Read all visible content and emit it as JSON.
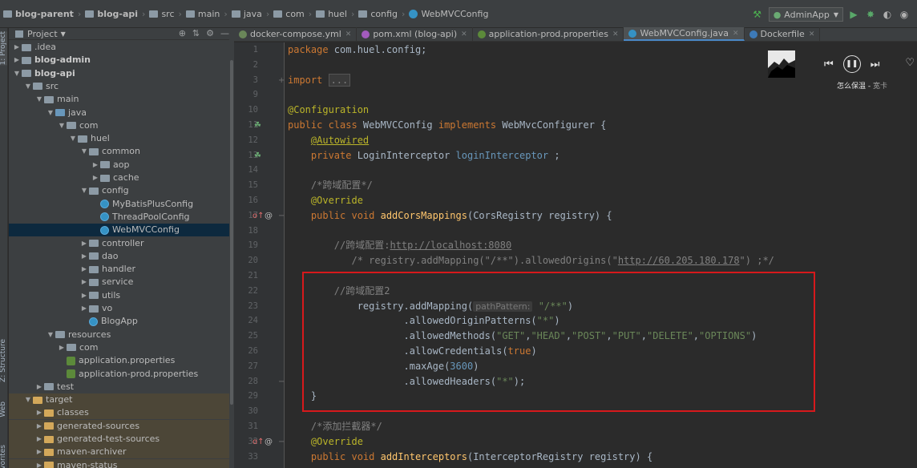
{
  "breadcrumb": [
    "blog-parent",
    "blog-api",
    "src",
    "main",
    "java",
    "com",
    "huel",
    "config",
    "WebMVCConfig"
  ],
  "run_config": "AdminApp",
  "left_strip": {
    "project": "1: Project",
    "structure": "Z: Structure",
    "web": "Web",
    "favorites": "Favorites"
  },
  "project_header": {
    "title": "Project"
  },
  "tree": [
    {
      "label": ".idea",
      "depth": 1,
      "expanded": false,
      "icon": "folder"
    },
    {
      "label": "blog-admin",
      "depth": 1,
      "expanded": false,
      "icon": "folder",
      "bold": true
    },
    {
      "label": "blog-api",
      "depth": 1,
      "expanded": true,
      "icon": "folder",
      "bold": true
    },
    {
      "label": "src",
      "depth": 2,
      "expanded": true,
      "icon": "folder"
    },
    {
      "label": "main",
      "depth": 3,
      "expanded": true,
      "icon": "folder"
    },
    {
      "label": "java",
      "depth": 4,
      "expanded": true,
      "icon": "folder-blue"
    },
    {
      "label": "com",
      "depth": 5,
      "expanded": true,
      "icon": "folder"
    },
    {
      "label": "huel",
      "depth": 6,
      "expanded": true,
      "icon": "folder"
    },
    {
      "label": "common",
      "depth": 7,
      "expanded": true,
      "icon": "folder"
    },
    {
      "label": "aop",
      "depth": 8,
      "expanded": false,
      "icon": "folder"
    },
    {
      "label": "cache",
      "depth": 8,
      "expanded": false,
      "icon": "folder"
    },
    {
      "label": "config",
      "depth": 7,
      "expanded": true,
      "icon": "folder"
    },
    {
      "label": "MyBatisPlusConfig",
      "depth": 8,
      "icon": "class"
    },
    {
      "label": "ThreadPoolConfig",
      "depth": 8,
      "icon": "class"
    },
    {
      "label": "WebMVCConfig",
      "depth": 8,
      "icon": "class",
      "selected": true
    },
    {
      "label": "controller",
      "depth": 7,
      "expanded": false,
      "icon": "folder"
    },
    {
      "label": "dao",
      "depth": 7,
      "expanded": false,
      "icon": "folder"
    },
    {
      "label": "handler",
      "depth": 7,
      "expanded": false,
      "icon": "folder"
    },
    {
      "label": "service",
      "depth": 7,
      "expanded": false,
      "icon": "folder"
    },
    {
      "label": "utils",
      "depth": 7,
      "expanded": false,
      "icon": "folder"
    },
    {
      "label": "vo",
      "depth": 7,
      "expanded": false,
      "icon": "folder"
    },
    {
      "label": "BlogApp",
      "depth": 7,
      "icon": "class"
    },
    {
      "label": "resources",
      "depth": 4,
      "expanded": true,
      "icon": "folder"
    },
    {
      "label": "com",
      "depth": 5,
      "expanded": false,
      "icon": "folder"
    },
    {
      "label": "application.properties",
      "depth": 5,
      "icon": "properties"
    },
    {
      "label": "application-prod.properties",
      "depth": 5,
      "icon": "properties"
    },
    {
      "label": "test",
      "depth": 3,
      "expanded": false,
      "icon": "folder"
    },
    {
      "label": "target",
      "depth": 2,
      "expanded": true,
      "icon": "folder-orange",
      "target": true
    },
    {
      "label": "classes",
      "depth": 3,
      "expanded": false,
      "icon": "folder-orange",
      "target": true
    },
    {
      "label": "generated-sources",
      "depth": 3,
      "expanded": false,
      "icon": "folder-orange",
      "target": true
    },
    {
      "label": "generated-test-sources",
      "depth": 3,
      "expanded": false,
      "icon": "folder-orange",
      "target": true
    },
    {
      "label": "maven-archiver",
      "depth": 3,
      "expanded": false,
      "icon": "folder-orange",
      "target": true
    },
    {
      "label": "maven-status",
      "depth": 3,
      "expanded": false,
      "icon": "folder-orange",
      "target": true
    }
  ],
  "tabs": [
    {
      "label": "docker-compose.yml",
      "icon": "#6a8759"
    },
    {
      "label": "pom.xml (blog-api)",
      "icon": "#a35bbd",
      "letter": "m"
    },
    {
      "label": "application-prod.properties",
      "icon": "#5c8a3a"
    },
    {
      "label": "WebMVCConfig.java",
      "icon": "#3592c4",
      "active": true
    },
    {
      "label": "Dockerfile",
      "icon": "#3d7ab8"
    }
  ],
  "code": [
    {
      "n": "1",
      "t": [
        [
          "kw",
          "package "
        ],
        [
          "",
          "com.huel.config;"
        ]
      ]
    },
    {
      "n": "2",
      "t": []
    },
    {
      "n": "3",
      "t": [
        [
          "kw",
          "import "
        ],
        [
          "fold-box",
          "..."
        ]
      ]
    },
    {
      "n": "9",
      "t": []
    },
    {
      "n": "10",
      "t": [
        [
          "an",
          "@Configuration"
        ]
      ]
    },
    {
      "n": "11",
      "t": [
        [
          "kw",
          "public class "
        ],
        [
          "",
          "WebMVCConfig "
        ],
        [
          "kw",
          "implements "
        ],
        [
          "",
          "WebMvcConfigurer {"
        ]
      ]
    },
    {
      "n": "12",
      "t": [
        [
          "",
          "    "
        ],
        [
          "an ul",
          "@Autowired"
        ]
      ]
    },
    {
      "n": "13",
      "t": [
        [
          "",
          "    "
        ],
        [
          "kw",
          "private "
        ],
        [
          "",
          "LoginInterceptor "
        ],
        [
          "nm",
          "loginInterceptor"
        ],
        [
          "",
          " ;"
        ]
      ]
    },
    {
      "n": "14",
      "t": []
    },
    {
      "n": "15",
      "t": [
        [
          "",
          "    "
        ],
        [
          "cm",
          "/*跨域配置*/"
        ]
      ]
    },
    {
      "n": "16",
      "t": [
        [
          "",
          "    "
        ],
        [
          "an",
          "@Override"
        ]
      ]
    },
    {
      "n": "17",
      "t": [
        [
          "",
          "    "
        ],
        [
          "kw",
          "public void "
        ],
        [
          "fn",
          "addCorsMappings"
        ],
        [
          "",
          "(CorsRegistry registry) {"
        ]
      ]
    },
    {
      "n": "18",
      "t": []
    },
    {
      "n": "19",
      "t": [
        [
          "",
          "        "
        ],
        [
          "cm",
          "//跨域配置:"
        ],
        [
          "cm ul",
          "http://localhost:8080"
        ]
      ]
    },
    {
      "n": "20",
      "t": [
        [
          "",
          "           "
        ],
        [
          "cm",
          "/* registry.addMapping(\"/**\").allowedOrigins(\""
        ],
        [
          "cm ul",
          "http://60.205.180.178"
        ],
        [
          "cm",
          "\") ;*/"
        ]
      ]
    },
    {
      "n": "21",
      "t": []
    },
    {
      "n": "22",
      "t": [
        [
          "",
          "        "
        ],
        [
          "cm",
          "//跨域配置2"
        ]
      ]
    },
    {
      "n": "23",
      "t": [
        [
          "",
          "            registry.addMapping("
        ],
        [
          "hint",
          "pathPattern:"
        ],
        [
          "st",
          " \"/**\""
        ],
        [
          "",
          ")"
        ]
      ]
    },
    {
      "n": "24",
      "t": [
        [
          "",
          "                    ."
        ],
        [
          "",
          "allowedOriginPatterns("
        ],
        [
          "st",
          "\"*\""
        ],
        [
          "",
          ")"
        ]
      ]
    },
    {
      "n": "25",
      "t": [
        [
          "",
          "                    ."
        ],
        [
          "",
          "allowedMethods("
        ],
        [
          "st",
          "\"GET\""
        ],
        [
          "",
          ","
        ],
        [
          "st",
          "\"HEAD\""
        ],
        [
          "",
          ","
        ],
        [
          "st",
          "\"POST\""
        ],
        [
          "",
          ","
        ],
        [
          "st",
          "\"PUT\""
        ],
        [
          "",
          ","
        ],
        [
          "st",
          "\"DELETE\""
        ],
        [
          "",
          ","
        ],
        [
          "st",
          "\"OPTIONS\""
        ],
        [
          "",
          ")"
        ]
      ]
    },
    {
      "n": "26",
      "t": [
        [
          "",
          "                    ."
        ],
        [
          "",
          "allowCredentials("
        ],
        [
          "kw",
          "true"
        ],
        [
          "",
          ")"
        ]
      ]
    },
    {
      "n": "27",
      "t": [
        [
          "",
          "                    ."
        ],
        [
          "",
          "maxAge("
        ],
        [
          "nm",
          "3600"
        ],
        [
          "",
          ")"
        ]
      ]
    },
    {
      "n": "28",
      "t": [
        [
          "",
          "                    ."
        ],
        [
          "",
          "allowedHeaders("
        ],
        [
          "st",
          "\"*\""
        ],
        [
          "",
          ");"
        ]
      ]
    },
    {
      "n": "29",
      "t": [
        [
          "",
          "    }"
        ]
      ]
    },
    {
      "n": "30",
      "t": []
    },
    {
      "n": "31",
      "t": [
        [
          "",
          "    "
        ],
        [
          "cm",
          "/*添加拦截器*/"
        ]
      ]
    },
    {
      "n": "32",
      "t": [
        [
          "",
          "    "
        ],
        [
          "an",
          "@Override"
        ]
      ]
    },
    {
      "n": "33",
      "t": [
        [
          "",
          "    "
        ],
        [
          "kw",
          "public void "
        ],
        [
          "fn",
          "addInterceptors"
        ],
        [
          "",
          "(InterceptorRegistry registry) {"
        ]
      ]
    }
  ],
  "player": {
    "title": "怎么保温",
    "artist": "宽卡"
  }
}
